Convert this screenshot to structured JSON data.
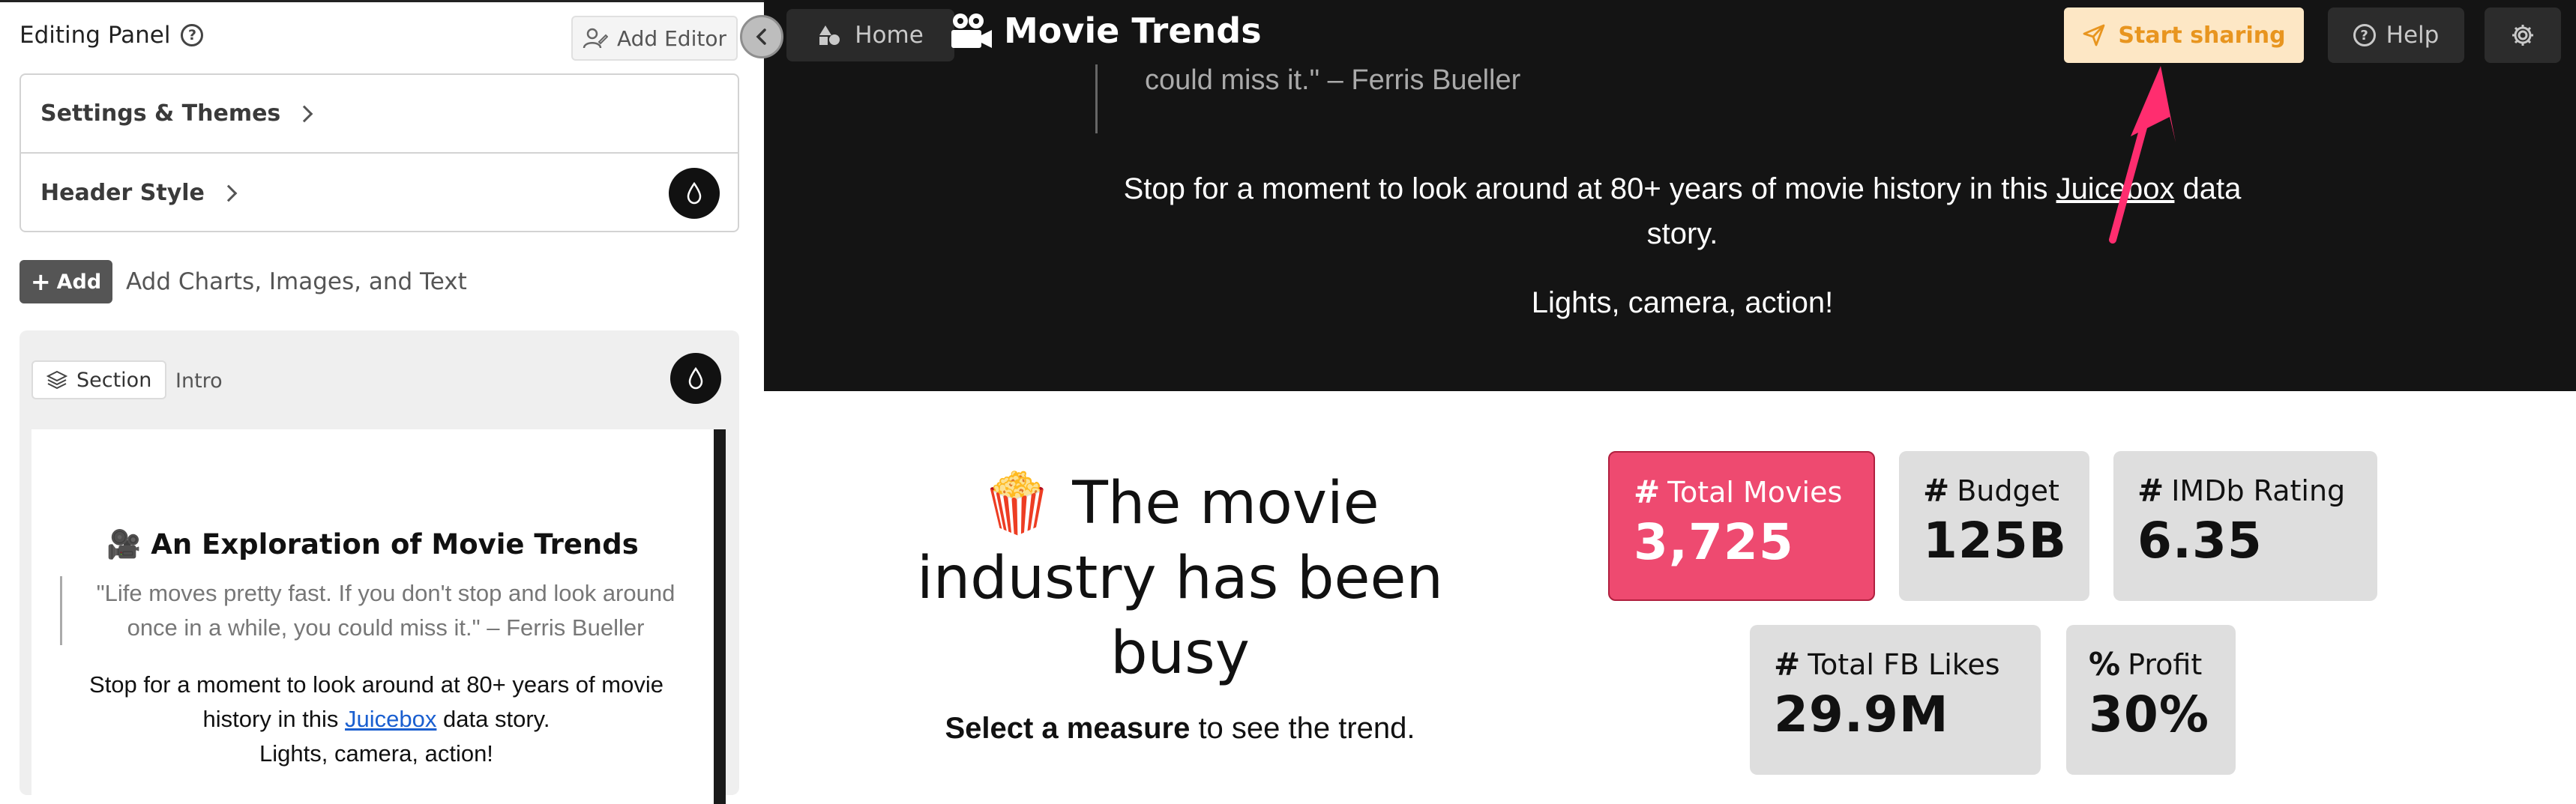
{
  "editor": {
    "panel_title": "Editing Panel",
    "add_editor_label": "Add Editor",
    "accordion": [
      {
        "label": "Settings & Themes"
      },
      {
        "label": "Header Style"
      }
    ],
    "add_button_label": "Add",
    "add_hint": "Add Charts, Images, and Text",
    "section": {
      "tag_label": "Section",
      "name": "Intro",
      "preview": {
        "title": "An Exploration of Movie Trends",
        "quote": "\"Life moves pretty fast. If you don't stop and look around once in a while, you could miss it.\" – Ferris Bueller",
        "body_before": "Stop for a moment to look around at 80+ years of movie history in this ",
        "body_link": "Juicebox",
        "body_after": " data story.",
        "tagline": "Lights, camera, action!"
      }
    }
  },
  "topbar": {
    "home_label": "Home",
    "title": "Movie Trends",
    "share_label": "Start sharing",
    "help_label": "Help"
  },
  "hero": {
    "quote_tail": "could miss it.\" – Ferris Bueller",
    "body_before": "Stop for a moment to look around at 80+ years of movie history in this ",
    "body_link": "Juicebox",
    "body_after": " data story.",
    "tagline": "Lights, camera, action!"
  },
  "measures": {
    "headline": "The movie industry has been busy",
    "prompt_bold": "Select a measure",
    "prompt_rest": " to see the trend.",
    "tiles": [
      {
        "symbol": "#",
        "label": "Total Movies",
        "value": "3,725",
        "active": true
      },
      {
        "symbol": "#",
        "label": "Budget",
        "value": "125B",
        "active": false
      },
      {
        "symbol": "#",
        "label": "IMDb Rating",
        "value": "6.35",
        "active": false
      },
      {
        "symbol": "#",
        "label": "Total FB Likes",
        "value": "29.9M",
        "active": false
      },
      {
        "symbol": "%",
        "label": "Profit",
        "value": "30%",
        "active": false
      }
    ]
  },
  "colors": {
    "accent_pink": "#ee4a70",
    "share_bg": "#fde7c5",
    "share_text": "#e8951f",
    "annotation_arrow": "#ff2d6f"
  }
}
